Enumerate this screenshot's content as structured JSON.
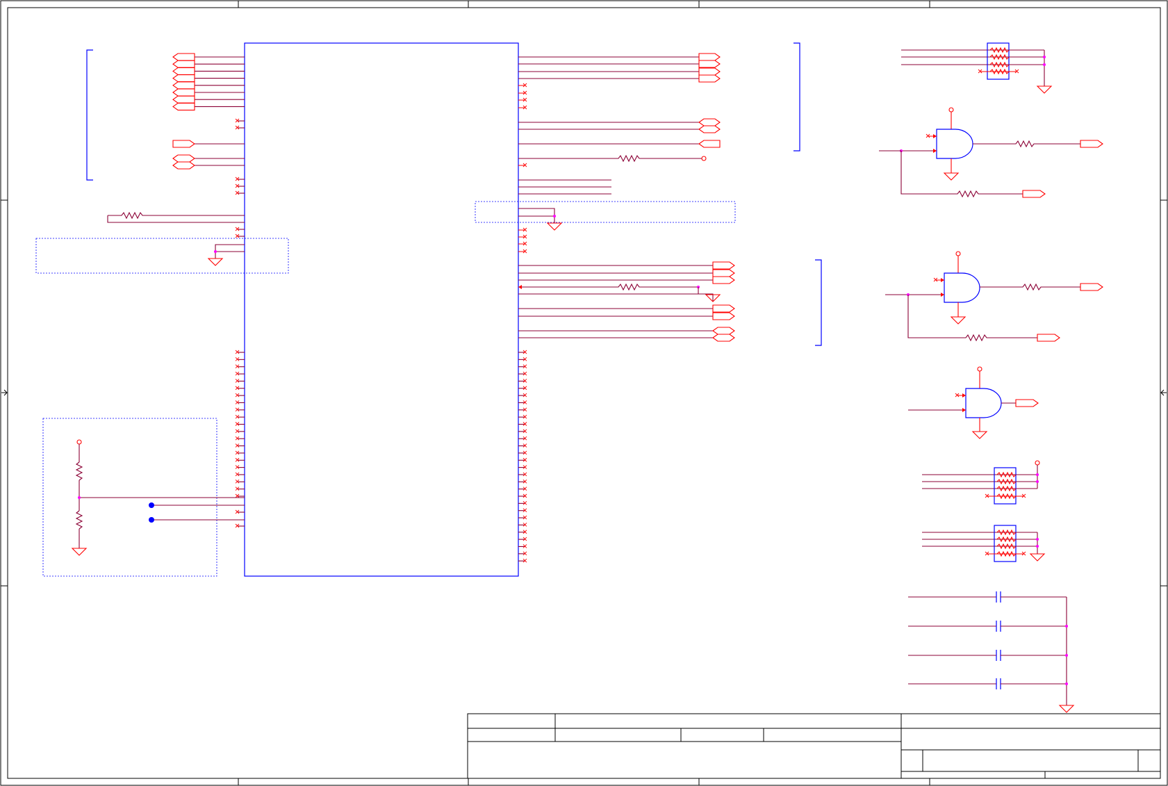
{
  "title": "",
  "colors": {
    "wire": "#8b0035",
    "component": "#ff0000",
    "part_body": "#0000ff",
    "junction": "#ff00ff",
    "frame": "#000000"
  },
  "title_block": {
    "cells": []
  }
}
